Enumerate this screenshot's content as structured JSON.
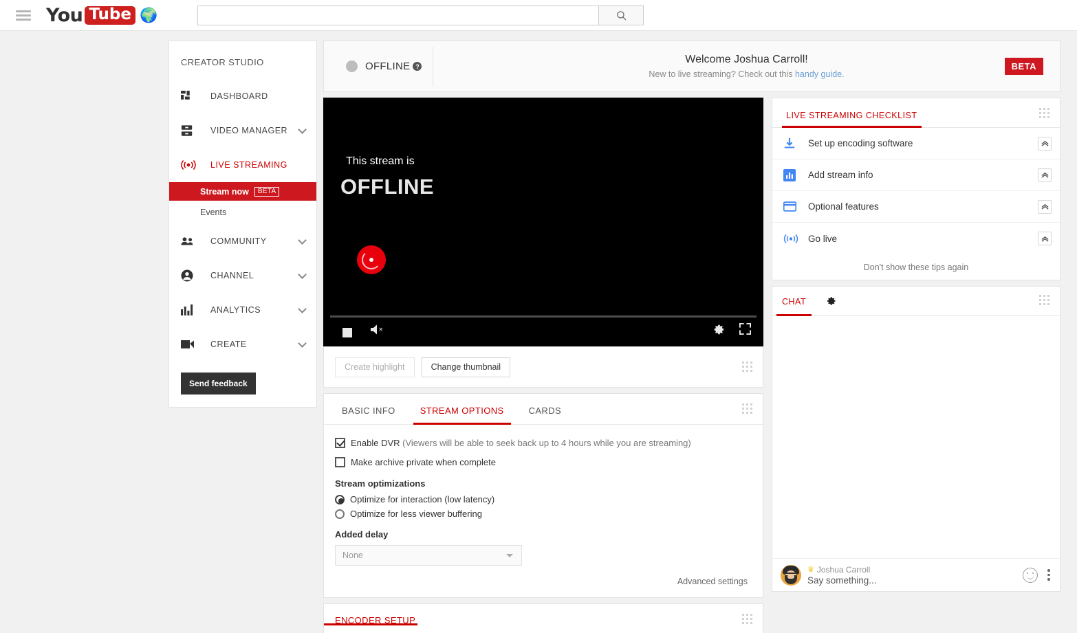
{
  "topbar": {
    "menu_icon": "hamburger-icon",
    "logo_you": "You",
    "logo_tube": "Tube",
    "logo_globe": "🌍",
    "search_value": "",
    "search_placeholder": "",
    "search_icon": "search-icon"
  },
  "sidebar": {
    "title": "CREATOR STUDIO",
    "items": [
      {
        "label": "DASHBOARD",
        "icon": "dashboard-icon",
        "expandable": false,
        "active": false
      },
      {
        "label": "VIDEO MANAGER",
        "icon": "video-manager-icon",
        "expandable": true,
        "active": false
      },
      {
        "label": "LIVE STREAMING",
        "icon": "live-streaming-icon",
        "expandable": false,
        "active": true
      },
      {
        "label": "COMMUNITY",
        "icon": "community-icon",
        "expandable": true,
        "active": false
      },
      {
        "label": "CHANNEL",
        "icon": "channel-icon",
        "expandable": true,
        "active": false
      },
      {
        "label": "ANALYTICS",
        "icon": "analytics-icon",
        "expandable": true,
        "active": false
      },
      {
        "label": "CREATE",
        "icon": "create-icon",
        "expandable": true,
        "active": false
      }
    ],
    "sub_items": [
      {
        "label": "Stream now",
        "badge": "BETA",
        "selected": true
      },
      {
        "label": "Events",
        "badge": "",
        "selected": false
      }
    ],
    "feedback_button": "Send feedback"
  },
  "welcome_bar": {
    "status_label": "OFFLINE",
    "status_color": "#bdbdbd",
    "help_icon": "help-icon",
    "title": "Welcome Joshua Carroll!",
    "subtitle_prefix": "New to live streaming? Check out this ",
    "subtitle_link": "handy guide",
    "subtitle_suffix": ".",
    "beta_badge": "BETA",
    "beta_color": "#cc181e"
  },
  "player": {
    "line1": "This stream is",
    "line2": "OFFLINE",
    "record_button": "record-button",
    "controls": {
      "stop": "stop-icon",
      "volume": "volume-muted-icon",
      "settings": "settings-gear-icon",
      "fullscreen": "fullscreen-icon"
    }
  },
  "player_actions": {
    "create_highlight": "Create highlight",
    "create_highlight_disabled": true,
    "change_thumbnail": "Change thumbnail"
  },
  "stream_tabs": [
    {
      "label": "BASIC INFO",
      "active": false
    },
    {
      "label": "STREAM OPTIONS",
      "active": true
    },
    {
      "label": "CARDS",
      "active": false
    }
  ],
  "stream_options": {
    "enable_dvr_label": "Enable DVR",
    "enable_dvr_note": " (Viewers will be able to seek back up to 4 hours while you are streaming)",
    "enable_dvr_checked": true,
    "make_private_label": "Make archive private when complete",
    "make_private_checked": false,
    "optimizations_title": "Stream optimizations",
    "radio_low_latency": "Optimize for interaction (low latency)",
    "radio_less_buffering": "Optimize for less viewer buffering",
    "selected_optimization": "low_latency",
    "added_delay_title": "Added delay",
    "added_delay_value": "None",
    "advanced_settings": "Advanced settings"
  },
  "encoder": {
    "tab_label": "ENCODER SETUP"
  },
  "checklist": {
    "title": "LIVE STREAMING CHECKLIST",
    "items": [
      {
        "label": "Set up encoding software",
        "icon": "download-icon"
      },
      {
        "label": "Add stream info",
        "icon": "bar-chart-icon"
      },
      {
        "label": "Optional features",
        "icon": "card-icon"
      },
      {
        "label": "Go live",
        "icon": "broadcast-icon"
      }
    ],
    "dismiss_label": "Don't show these tips again",
    "icon_color": "#4285f4"
  },
  "chat": {
    "tab_label": "CHAT",
    "settings_icon": "gear-icon",
    "user_name": "Joshua Carroll",
    "badge_icon": "crown-icon",
    "input_placeholder": "Say something...",
    "emoji_icon": "emoji-icon",
    "more_icon": "kebab-menu-icon"
  }
}
